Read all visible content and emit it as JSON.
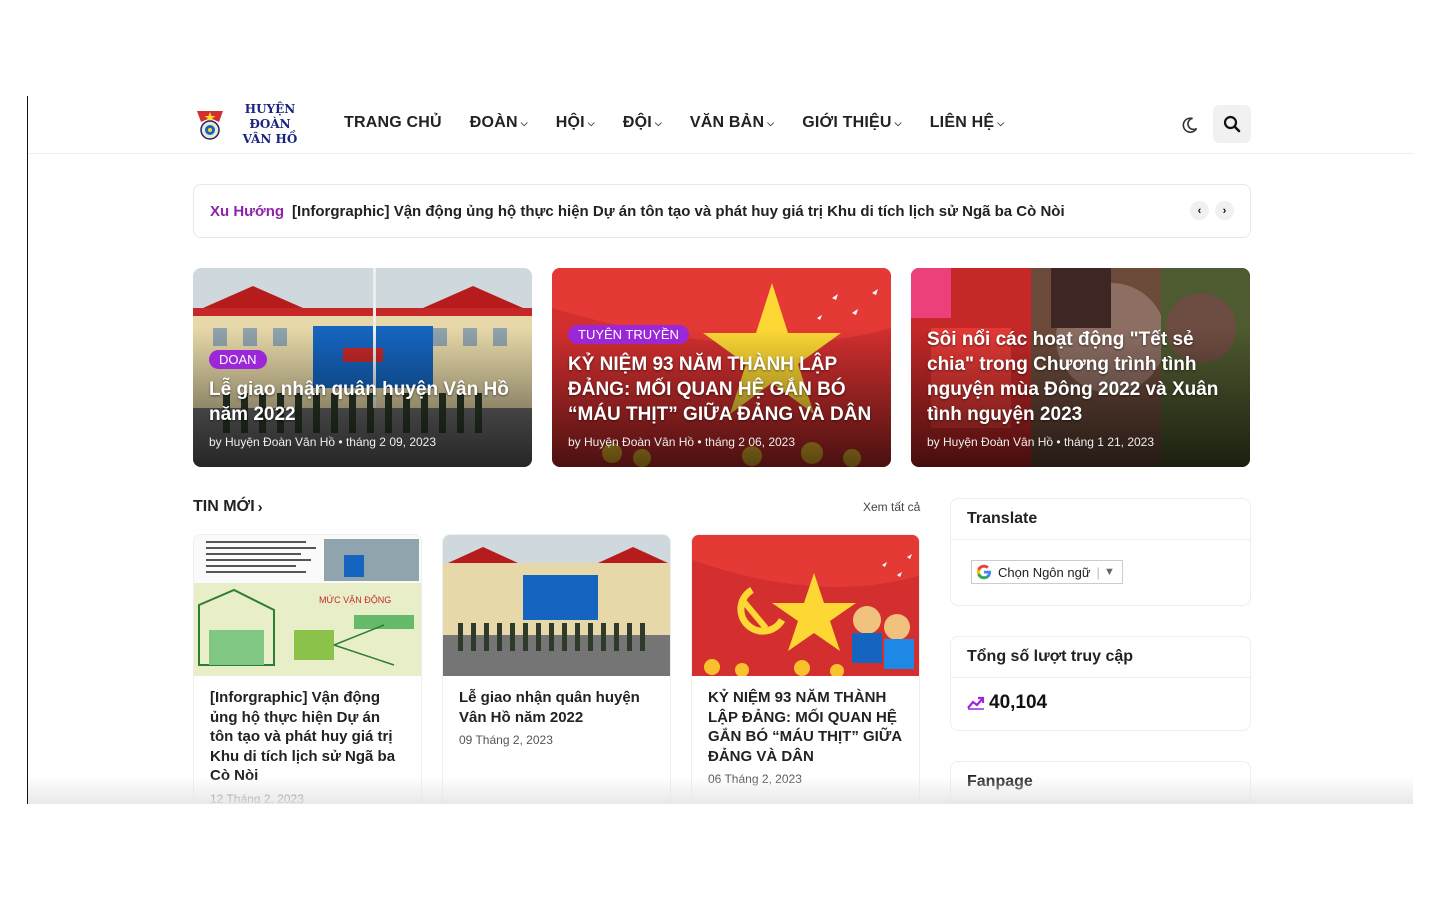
{
  "logo": {
    "line1": "HUYỆN ĐOÀN",
    "line2": "VÂN HỒ"
  },
  "nav": [
    {
      "label": "TRANG CHỦ",
      "dropdown": false
    },
    {
      "label": "ĐOÀN",
      "dropdown": true
    },
    {
      "label": "HỘI",
      "dropdown": true
    },
    {
      "label": "ĐỘI",
      "dropdown": true
    },
    {
      "label": "VĂN BẢN",
      "dropdown": true
    },
    {
      "label": "GIỚI THIỆU",
      "dropdown": true
    },
    {
      "label": "LIÊN HỆ",
      "dropdown": true
    }
  ],
  "header_icons": {
    "theme": "moon-icon",
    "search": "search-icon"
  },
  "trending": {
    "label": "Xu Hướng",
    "text": "[Inforgraphic] Vận động ủng hộ thực hiện Dự án tôn tạo và phát huy giá trị Khu di tích lịch sử Ngã ba Cò Nòi",
    "prev": "‹",
    "next": "›"
  },
  "hero": [
    {
      "tag": "DOAN",
      "title": "Lễ giao nhận quân huyện Vân Hồ năm 2022",
      "meta": "by Huyện Đoàn Vân Hồ • tháng 2 09, 2023"
    },
    {
      "tag": "TUYÊN TRUYỀN",
      "title": "KỶ NIỆM 93 NĂM THÀNH LẬP ĐẢNG: MỐI QUAN HỆ GẮN BÓ “MÁU THỊT” GIỮA ĐẢNG VÀ DÂN",
      "meta": "by Huyện Đoàn Vân Hồ • tháng 2 06, 2023"
    },
    {
      "tag": "",
      "title": "Sôi nổi các hoạt động \"Tết sẻ chia\" trong Chương trình tình nguyện mùa Đông 2022 và Xuân tình nguyện 2023",
      "meta": "by Huyện Đoàn Vân Hồ • tháng 1 21, 2023"
    }
  ],
  "latest": {
    "title": "TIN MỚI",
    "view_all": "Xem tất cả",
    "thumb1_label": "MỨC VẬN ĐỘNG",
    "posts": [
      {
        "title": "[Inforgraphic] Vận động ủng hộ thực hiện Dự án tôn tạo và phát huy giá trị Khu di tích lịch sử Ngã ba Cò Nòi",
        "date": "12 Tháng 2, 2023"
      },
      {
        "title": "Lễ giao nhận quân huyện Vân Hồ năm 2022",
        "date": "09 Tháng 2, 2023"
      },
      {
        "title": "KỶ NIỆM 93 NĂM THÀNH LẬP ĐẢNG: MỐI QUAN HỆ GẮN BÓ “MÁU THỊT” GIỮA ĐẢNG VÀ DÂN",
        "date": "06 Tháng 2, 2023"
      }
    ]
  },
  "sidebar": {
    "translate_title": "Translate",
    "translate_select": "Chọn Ngôn ngữ",
    "visits_title": "Tổng số lượt truy cập",
    "visits_count": "40,104",
    "fanpage_title": "Fanpage"
  },
  "colors": {
    "accent": "#9c27d8",
    "trend_label": "#8e24aa",
    "flag_red": "#d32f2f",
    "star_yellow": "#fdd835"
  }
}
